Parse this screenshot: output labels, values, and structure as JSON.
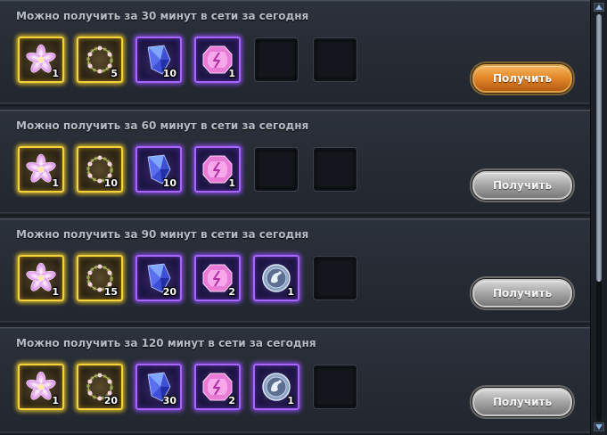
{
  "panels": [
    {
      "title": "Можно получить за 30 минут в сети за сегодня",
      "button": {
        "label": "Получить",
        "state": "active"
      },
      "slots": [
        {
          "rarity": "gold",
          "icon": "flower-icon",
          "count": "1"
        },
        {
          "rarity": "gold",
          "icon": "wreath-icon",
          "count": "5"
        },
        {
          "rarity": "purple",
          "icon": "blue-crystal-icon",
          "count": "10"
        },
        {
          "rarity": "purple",
          "icon": "pink-gem-icon",
          "count": "1"
        },
        {
          "rarity": "empty"
        },
        {
          "rarity": "empty"
        }
      ]
    },
    {
      "title": "Можно получить за 60 минут в сети за сегодня",
      "button": {
        "label": "Получить",
        "state": "disabled"
      },
      "slots": [
        {
          "rarity": "gold",
          "icon": "flower-icon",
          "count": "1"
        },
        {
          "rarity": "gold",
          "icon": "wreath-icon",
          "count": "10"
        },
        {
          "rarity": "purple",
          "icon": "blue-crystal-icon",
          "count": "10"
        },
        {
          "rarity": "purple",
          "icon": "pink-gem-icon",
          "count": "1"
        },
        {
          "rarity": "empty"
        },
        {
          "rarity": "empty"
        }
      ]
    },
    {
      "title": "Можно получить за 90 минут в сети за сегодня",
      "button": {
        "label": "Получить",
        "state": "disabled"
      },
      "slots": [
        {
          "rarity": "gold",
          "icon": "flower-icon",
          "count": "1"
        },
        {
          "rarity": "gold",
          "icon": "wreath-icon",
          "count": "15"
        },
        {
          "rarity": "purple",
          "icon": "blue-crystal-icon",
          "count": "20"
        },
        {
          "rarity": "purple",
          "icon": "pink-gem-icon",
          "count": "2"
        },
        {
          "rarity": "purple",
          "icon": "silver-coin-icon",
          "count": "1"
        },
        {
          "rarity": "empty"
        }
      ]
    },
    {
      "title": "Можно получить за 120 минут в сети за сегодня",
      "button": {
        "label": "Получить",
        "state": "disabled"
      },
      "slots": [
        {
          "rarity": "gold",
          "icon": "flower-icon",
          "count": "1"
        },
        {
          "rarity": "gold",
          "icon": "wreath-icon",
          "count": "20"
        },
        {
          "rarity": "purple",
          "icon": "blue-crystal-icon",
          "count": "30"
        },
        {
          "rarity": "purple",
          "icon": "pink-gem-icon",
          "count": "2"
        },
        {
          "rarity": "purple",
          "icon": "silver-coin-icon",
          "count": "1"
        },
        {
          "rarity": "empty"
        }
      ]
    }
  ],
  "colors": {
    "gold_glow": "#f3d23a",
    "purple_glow": "#a864ff",
    "active_button": "#e48a2c",
    "disabled_button": "#a9a9a9",
    "title_text": "#b6bcc5"
  }
}
